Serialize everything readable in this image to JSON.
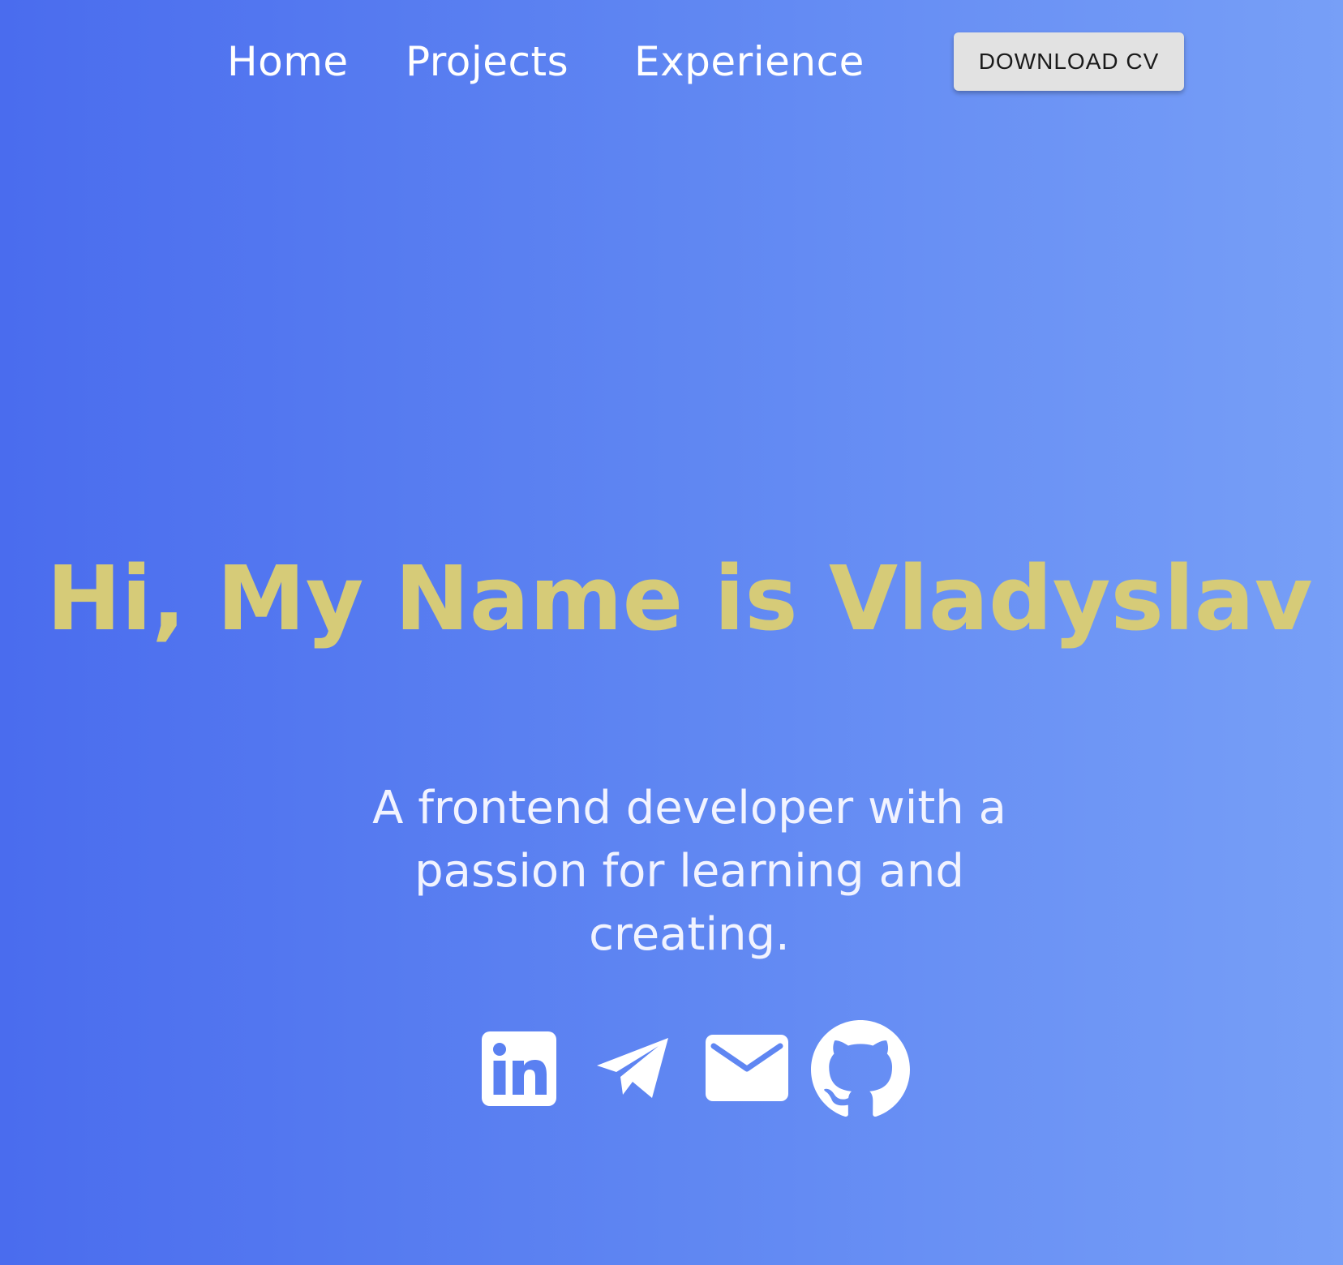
{
  "nav": {
    "items": [
      {
        "label": "Home"
      },
      {
        "label": "Projects"
      },
      {
        "label": "Experience"
      }
    ],
    "cv_button_label": "DOWNLOAD CV"
  },
  "hero": {
    "title": "Hi, My Name is Vladyslav",
    "subtitle": "A frontend developer with a passion for learning and creating."
  },
  "social": [
    {
      "icon": "linkedin-icon"
    },
    {
      "icon": "telegram-icon"
    },
    {
      "icon": "mail-icon"
    },
    {
      "icon": "github-icon"
    }
  ],
  "colors": {
    "background_start": "#4a6cee",
    "background_end": "#779ff7",
    "title": "#d6cb78",
    "text": "#ffffff",
    "button_bg": "#e2e2e2",
    "button_text": "#1a1a1a"
  }
}
